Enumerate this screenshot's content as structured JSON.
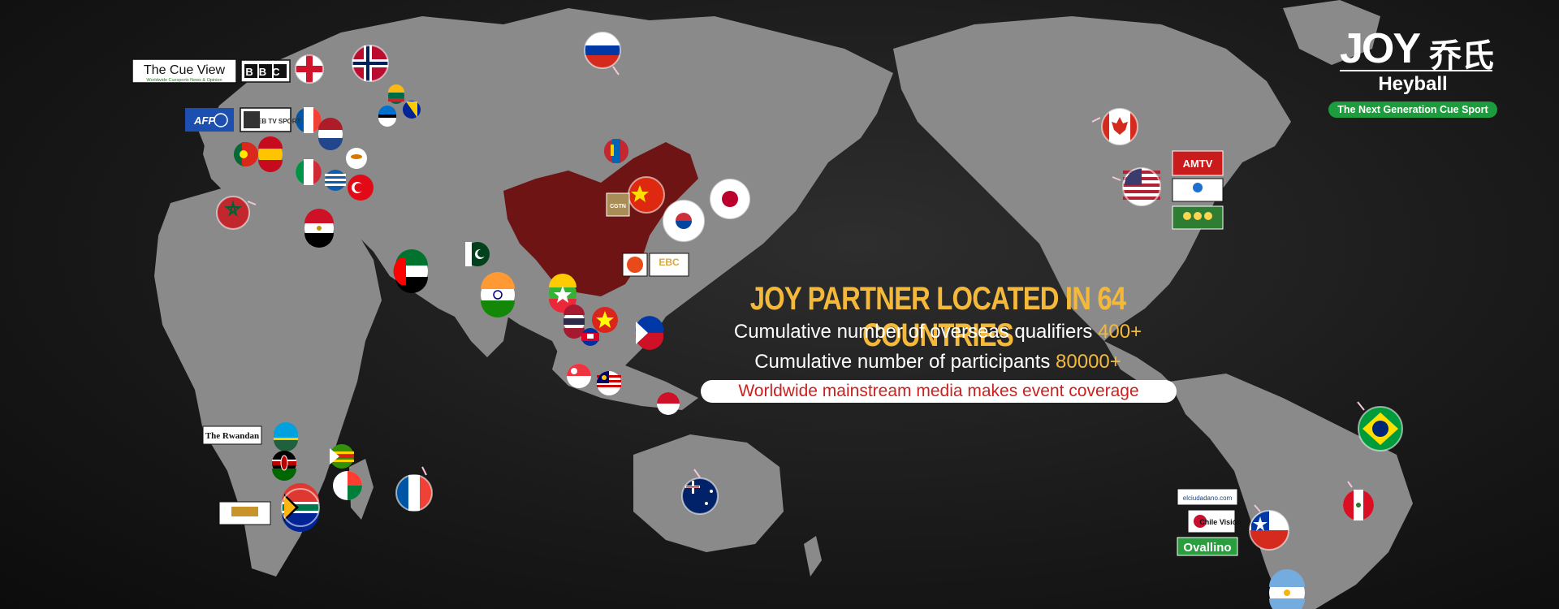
{
  "headline": "JOY PARTNER LOCATED IN 64 COUNTRIES",
  "stats": [
    {
      "label": "Cumulative number of overseas qualifiers",
      "value": "400+"
    },
    {
      "label": "Cumulative number of participants",
      "value": "80000+"
    }
  ],
  "coverage": "Worldwide mainstream media makes event coverage",
  "logo": {
    "mark": "JOY",
    "chinese": "乔氏",
    "brand": "Heyball",
    "slogan": "The Next Generation Cue Sport"
  },
  "media": {
    "cue_view": "The Cue View",
    "cue_view_sub": "Worldwide Cuesports News & Opinion",
    "bbc": "BBC",
    "afp": "AFP",
    "webtv": "WEB TV SPORT",
    "cgtn": "CGTN",
    "ebc": "EBC",
    "amtv": "AMTV",
    "rwandan": "The Rwandan",
    "elciudadano": "elciudadano.com",
    "chilevision": "Chile Visión",
    "ovallino": "Ovallino"
  },
  "colors": {
    "accent_gold": "#f4b93a",
    "highlight_red": "#cc1f1f",
    "china_fill": "#6e1414",
    "land_grey": "#8a8a8a",
    "slogan_green": "#1c9c3c"
  }
}
